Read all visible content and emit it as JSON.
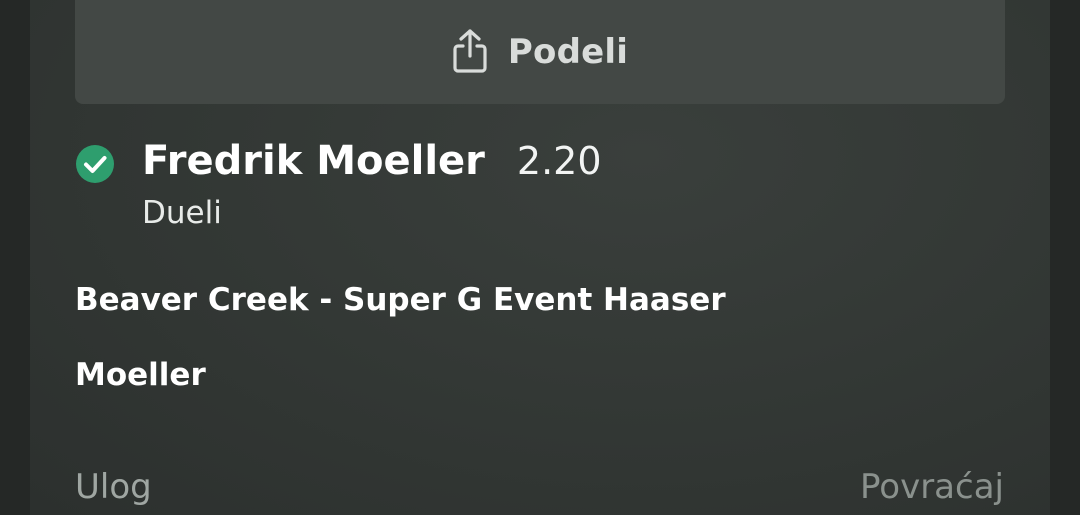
{
  "share": {
    "label": "Podeli",
    "icon": "share-icon"
  },
  "selection": {
    "status_icon": "check-circle-icon",
    "status_color": "#2e9e6e",
    "name": "Fredrik Moeller",
    "odds": "2.20",
    "market": "Dueli"
  },
  "event": {
    "title": "Beaver Creek - Super G Event Haaser",
    "pick": "Moeller"
  },
  "footer": {
    "stake_label": "Ulog",
    "return_label": "Povraćaj"
  }
}
